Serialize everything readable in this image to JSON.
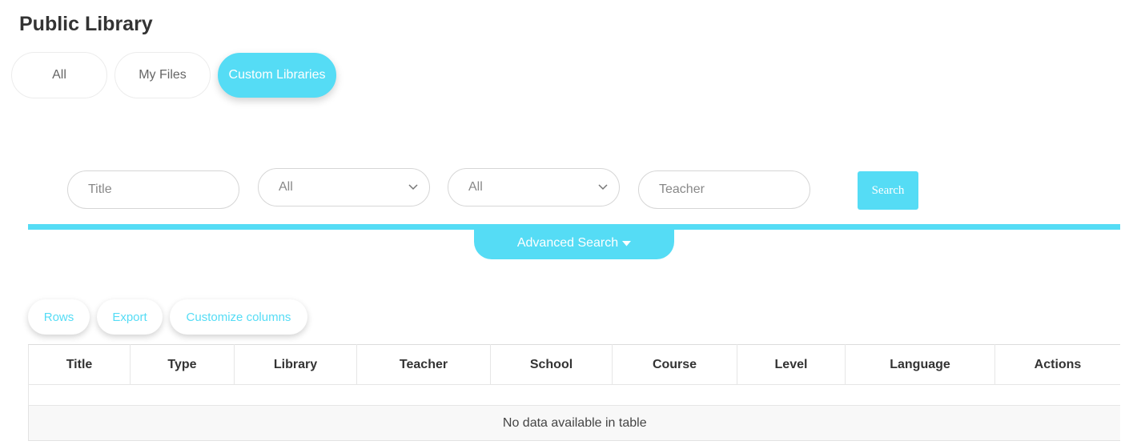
{
  "page": {
    "title": "Public Library"
  },
  "tabs": [
    {
      "label": "All",
      "active": false
    },
    {
      "label": "My Files",
      "active": false
    },
    {
      "label": "Custom Libraries",
      "active": true
    }
  ],
  "filters": {
    "title_placeholder": "Title",
    "select1_value": "All",
    "select2_value": "All",
    "teacher_placeholder": "Teacher",
    "search_label": "Search"
  },
  "advanced_search": {
    "label": "Advanced Search",
    "icon": "caret-down-icon"
  },
  "toolbar": {
    "rows": "Rows",
    "export": "Export",
    "customize": "Customize columns"
  },
  "table": {
    "columns": [
      "Title",
      "Type",
      "Library",
      "Teacher",
      "School",
      "Course",
      "Level",
      "Language",
      "Actions"
    ],
    "empty_message": "No data available in table"
  },
  "colors": {
    "accent": "#55dcf5"
  }
}
